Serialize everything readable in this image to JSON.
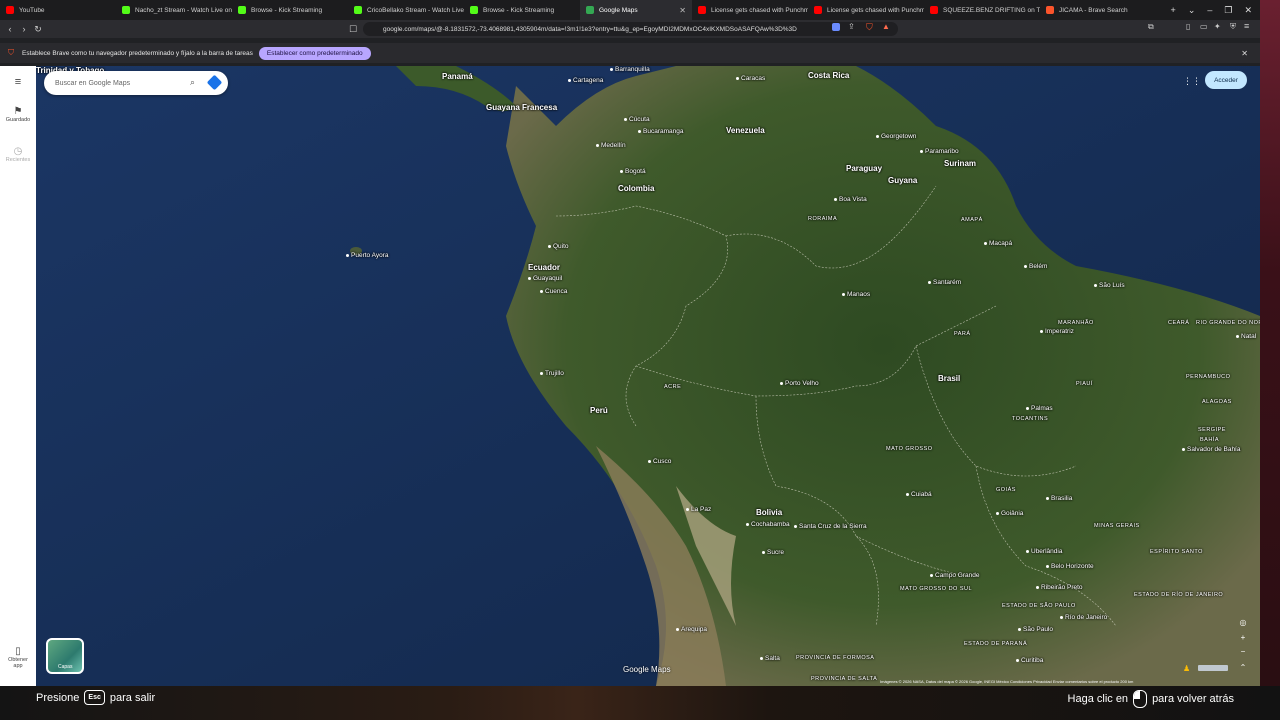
{
  "tabs": [
    {
      "label": "YouTube",
      "color": "#ff0000",
      "active": false
    },
    {
      "label": "Nacho_zt Stream - Watch Live on Kick",
      "color": "#53fc18",
      "active": false
    },
    {
      "label": "Browse - Kick Streaming",
      "color": "#53fc18",
      "active": false
    },
    {
      "label": "CricoBellako Stream - Watch Live on Kick",
      "color": "#53fc18",
      "active": false
    },
    {
      "label": "Browse - Kick Streaming",
      "color": "#53fc18",
      "active": false
    },
    {
      "label": "Google Maps",
      "color": "#34a853",
      "active": true
    },
    {
      "label": "License gets chased with Punchmade",
      "color": "#ff0000",
      "active": false
    },
    {
      "label": "License gets chased with Punchmade",
      "color": "#ff0000",
      "active": false
    },
    {
      "label": "SQUEEZE.BENZ DRIFTING on TIME",
      "color": "#ff0000",
      "active": false
    },
    {
      "label": "JICAMA - Brave Search",
      "color": "#fb542b",
      "active": false
    }
  ],
  "address": {
    "url": "google.com/maps/@-8.1831572,-73.4068981,4305904m/data=!3m1!1e3?entry=ttu&g_ep=EgoyMDI2MDMxOC4xIKXMDSoASAFQAw%3D%3D"
  },
  "infobar": {
    "message": "Establece Brave como tu navegador predeterminado y fíjalo a la barra de tareas",
    "button": "Establecer como predeterminado"
  },
  "sidebar": {
    "saved": "Guardado",
    "recent": "Recientes",
    "get_app_line1": "Obtener",
    "get_app_line2": "app"
  },
  "search": {
    "placeholder": "Buscar en Google Maps"
  },
  "header": {
    "sign_in": "Acceder"
  },
  "layers": {
    "label": "Capas"
  },
  "map": {
    "logo": "Google Maps",
    "attribution": "Imágenes © 2026 NASA, Datos del mapa © 2026 Google, INEGI   México   Condiciones   Privacidad   Enviar comentarios sobre el producto   200 km",
    "countries": [
      {
        "name": "Venezuela"
      },
      {
        "name": "Colombia"
      },
      {
        "name": "Ecuador"
      },
      {
        "name": "Perú"
      },
      {
        "name": "Bolivia"
      },
      {
        "name": "Brasil"
      },
      {
        "name": "Paraguay"
      },
      {
        "name": "Guyana"
      },
      {
        "name": "Surinam"
      },
      {
        "name": "Guayana Francesa"
      },
      {
        "name": "Panamá"
      },
      {
        "name": "Costa Rica"
      },
      {
        "name": "Trinidad y Tobago"
      }
    ],
    "cities": [
      {
        "name": "Barranquilla"
      },
      {
        "name": "Cartagena"
      },
      {
        "name": "Caracas"
      },
      {
        "name": "Cúcuta"
      },
      {
        "name": "Bucaramanga"
      },
      {
        "name": "Medellín"
      },
      {
        "name": "Bogotá"
      },
      {
        "name": "Georgetown"
      },
      {
        "name": "Paramaribo"
      },
      {
        "name": "Boa Vista"
      },
      {
        "name": "Quito"
      },
      {
        "name": "Guayaquil"
      },
      {
        "name": "Cuenca"
      },
      {
        "name": "Macapá"
      },
      {
        "name": "Belém"
      },
      {
        "name": "São Luís"
      },
      {
        "name": "Manaos"
      },
      {
        "name": "Santarém"
      },
      {
        "name": "Natal"
      },
      {
        "name": "Trujillo"
      },
      {
        "name": "Porto Velho"
      },
      {
        "name": "Palmas"
      },
      {
        "name": "Salvador de Bahía"
      },
      {
        "name": "Cusco"
      },
      {
        "name": "La Paz"
      },
      {
        "name": "Cochabamba"
      },
      {
        "name": "Santa Cruz de la Sierra"
      },
      {
        "name": "Cuiabá"
      },
      {
        "name": "Brasilia"
      },
      {
        "name": "Goiânia"
      },
      {
        "name": "Uberlândia"
      },
      {
        "name": "Belo Horizonte"
      },
      {
        "name": "Campo Grande"
      },
      {
        "name": "Ribeirão Preto"
      },
      {
        "name": "São Paulo"
      },
      {
        "name": "Río de Janeiro"
      },
      {
        "name": "Curitiba"
      },
      {
        "name": "Arequipa"
      },
      {
        "name": "Sucre"
      },
      {
        "name": "Salta"
      },
      {
        "name": "Puerto Ayora"
      },
      {
        "name": "Imperatriz"
      }
    ],
    "regions": [
      {
        "name": "RORAIMA"
      },
      {
        "name": "AMAPÁ"
      },
      {
        "name": "PARÁ"
      },
      {
        "name": "MARANHÃO"
      },
      {
        "name": "CEARÁ"
      },
      {
        "name": "RIO GRANDE DO NORTE"
      },
      {
        "name": "PERNAMBUCO"
      },
      {
        "name": "ALAGOAS"
      },
      {
        "name": "SERGIPE"
      },
      {
        "name": "TOCANTINS"
      },
      {
        "name": "BAHÍA"
      },
      {
        "name": "ACRE"
      },
      {
        "name": "MATO GROSSO"
      },
      {
        "name": "GOIÁS"
      },
      {
        "name": "MINAS GERAIS"
      },
      {
        "name": "ESPÍRITO SANTO"
      },
      {
        "name": "MATO GROSSO DO SUL"
      },
      {
        "name": "ESTADO DE SÃO PAULO"
      },
      {
        "name": "ESTADO DE RÍO DE JANEIRO"
      },
      {
        "name": "ESTADO DE PARANÁ"
      },
      {
        "name": "PROVINCIA DE FORMOSA"
      },
      {
        "name": "PROVINCIA DE SALTA"
      },
      {
        "name": "PIAUÍ"
      }
    ]
  },
  "overlay": {
    "esc_prefix": "Presione",
    "esc_key": "Esc",
    "esc_suffix": "para salir",
    "back_prefix": "Haga clic en",
    "back_suffix": "para volver atrás"
  },
  "colors": {
    "ocean": "#17305a",
    "land": "#3e5a2c",
    "accent": "#1a73e8"
  }
}
